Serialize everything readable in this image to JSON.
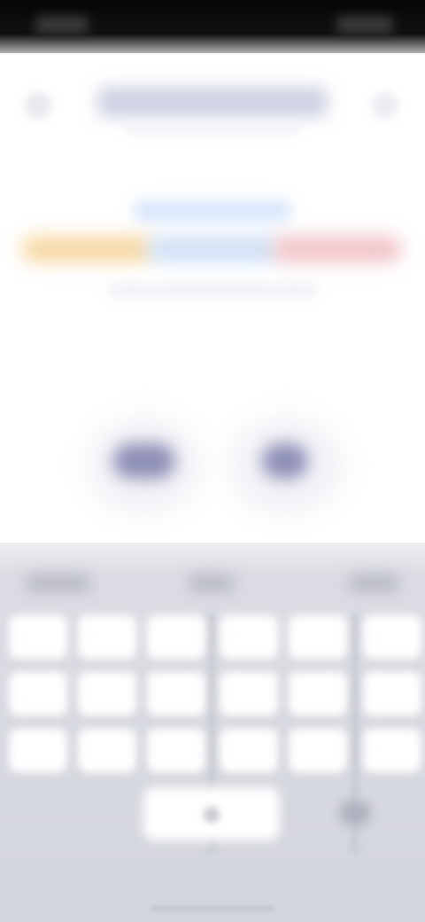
{
  "screen": {
    "description_visible_text": "",
    "colors": {
      "status_bar": "#050505",
      "background": "#ffffff",
      "title_blur": "#cdd1e2",
      "tab_highlight": "#d7e6fb",
      "band_yellow": "#f7d9a4",
      "band_blue": "#cfe0f6",
      "band_red": "#f1c4c8",
      "number_blur": "#8e8fb6",
      "keyboard": "#d3d5dd",
      "key": "#ffffff"
    }
  },
  "keyboard": {
    "rows": 3,
    "keys_per_row": 6
  }
}
